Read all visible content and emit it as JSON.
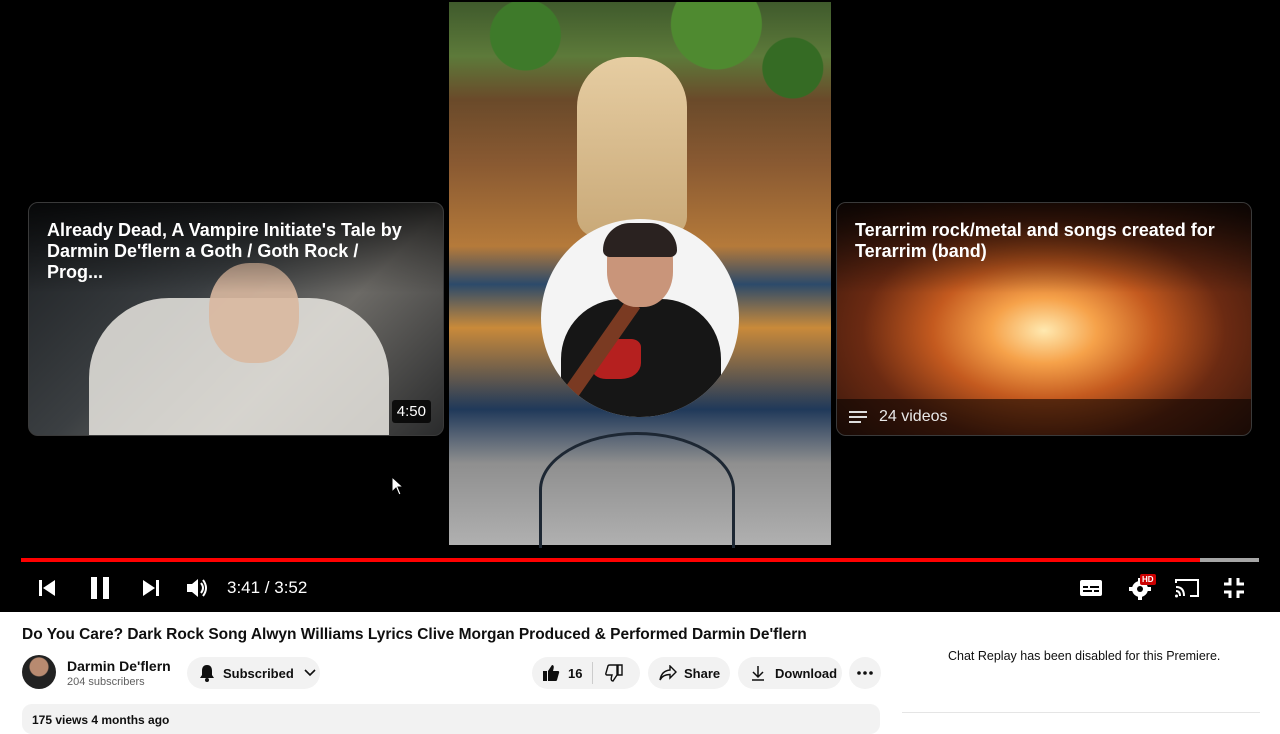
{
  "player": {
    "end_cards": {
      "left": {
        "title": "Already Dead, A Vampire Initiate's Tale by Darmin De'flern a Goth / Goth Rock / Prog...",
        "duration": "4:50"
      },
      "right": {
        "title": "Terarrim rock/metal and songs created for Terarrim (band)",
        "video_count": "24 videos"
      }
    },
    "progress": {
      "played_fraction": 0.952,
      "buffered_fraction": 1.0
    },
    "time_display": "3:41 / 3:52",
    "colors": {
      "progress": "#ff0000",
      "hd_badge": "#cc0000"
    },
    "icons": [
      "previous-icon",
      "pause-icon",
      "next-icon",
      "volume-icon",
      "subtitles-icon",
      "settings-icon",
      "cast-icon",
      "exit-fullscreen-icon"
    ],
    "hd_badge": "HD"
  },
  "video": {
    "title": "Do You Care? Dark Rock Song Alwyn Williams Lyrics Clive Morgan Produced & Performed Darmin De'flern",
    "channel_name": "Darmin De'flern",
    "subscribers": "204 subscribers",
    "subscribe_label": "Subscribed",
    "likes": "16",
    "share_label": "Share",
    "download_label": "Download",
    "description_preview": "175 views  4 months ago"
  },
  "chat": {
    "note": "Chat Replay has been disabled for this Premiere."
  }
}
